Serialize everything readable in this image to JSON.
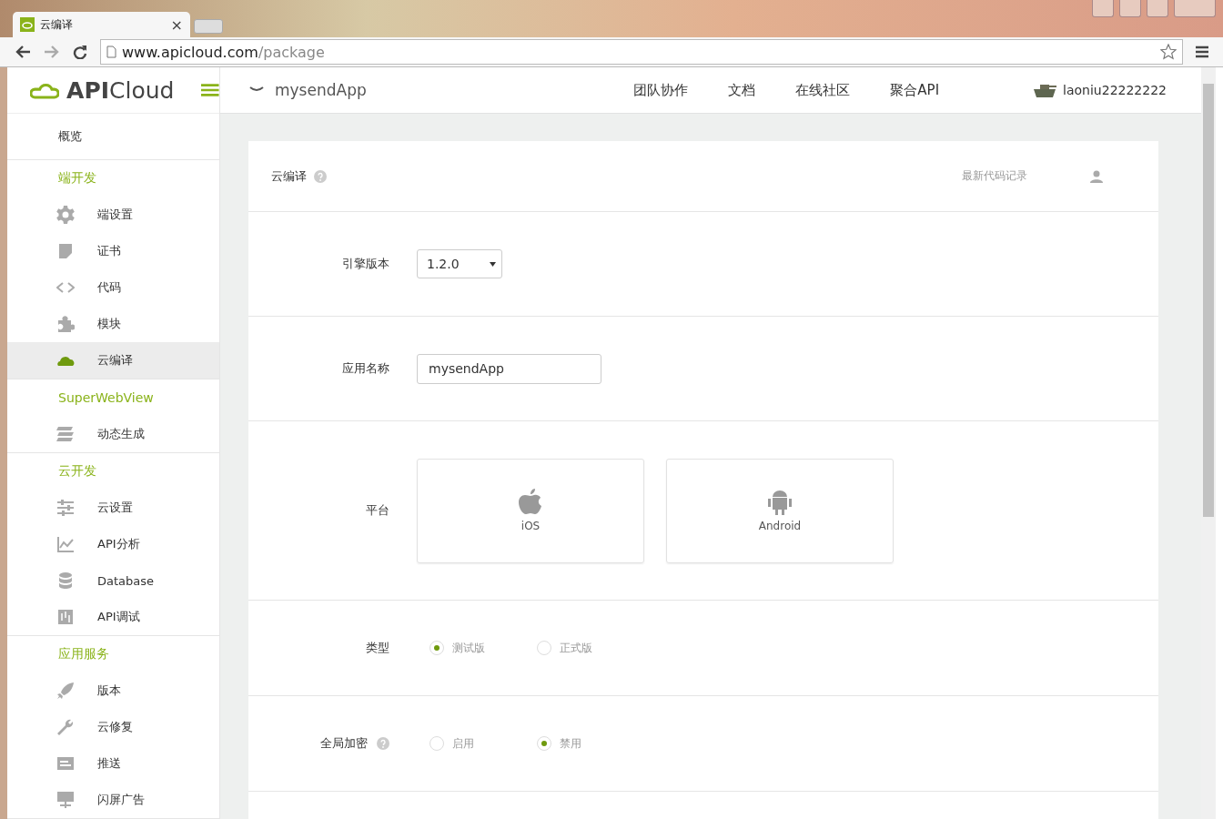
{
  "browser": {
    "tab_title": "云编译",
    "tab_close": "×",
    "url_host": "www.apicloud.com",
    "url_path": "/package"
  },
  "brand": {
    "name_bold": "API",
    "name_light": "Cloud"
  },
  "sidebar": {
    "overview": {
      "label": "概览",
      "selected": false
    },
    "sections": [
      {
        "title": "端开发",
        "items": [
          {
            "label": "端设置",
            "selected": false
          },
          {
            "label": "证书",
            "selected": false
          },
          {
            "label": "代码",
            "selected": false
          },
          {
            "label": "模块",
            "selected": false
          },
          {
            "label": "云编译",
            "selected": true
          }
        ]
      },
      {
        "title": "SuperWebView",
        "items": [
          {
            "label": "动态生成",
            "selected": false
          }
        ]
      },
      {
        "title": "云开发",
        "items": [
          {
            "label": "云设置",
            "selected": false
          },
          {
            "label": "API分析",
            "selected": false
          },
          {
            "label": "Database",
            "selected": false
          },
          {
            "label": "API调试",
            "selected": false
          }
        ]
      },
      {
        "title": "应用服务",
        "items": [
          {
            "label": "版本",
            "selected": false
          },
          {
            "label": "云修复",
            "selected": false
          },
          {
            "label": "推送",
            "selected": false
          },
          {
            "label": "闪屏广告",
            "selected": false
          }
        ]
      }
    ]
  },
  "topbar": {
    "app_name": "mysendApp",
    "nav": [
      "团队协作",
      "文档",
      "在线社区",
      "聚合API"
    ],
    "user": "laoniu22222222"
  },
  "card": {
    "title": "云编译",
    "link": "最新代码记录",
    "rows": [
      {
        "kind": "select",
        "label": "引擎版本",
        "value": "1.2.0"
      },
      {
        "kind": "input",
        "label": "应用名称",
        "value": "mysendApp"
      },
      {
        "kind": "platforms",
        "label": "平台",
        "options": [
          "iOS",
          "Android"
        ]
      },
      {
        "kind": "radio",
        "label": "类型",
        "help": false,
        "options": [
          {
            "label": "测试版",
            "selected": true
          },
          {
            "label": "正式版",
            "selected": false
          }
        ]
      },
      {
        "kind": "radio",
        "label": "全局加密",
        "help": true,
        "options": [
          {
            "label": "启用",
            "selected": false
          },
          {
            "label": "禁用",
            "selected": true
          }
        ]
      }
    ]
  }
}
